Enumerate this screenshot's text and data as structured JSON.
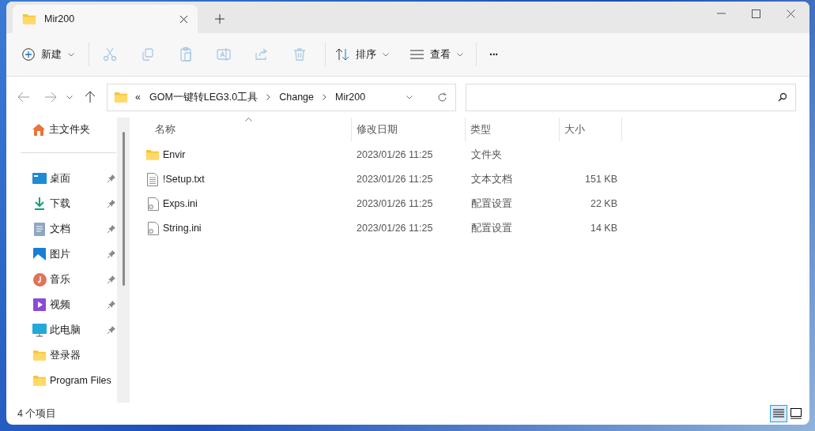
{
  "tabs": [
    {
      "title": "Mir200",
      "selected": true
    }
  ],
  "toolbar": {
    "new": "新建",
    "sort": "排序",
    "view": "查看",
    "more": "···"
  },
  "toolbar_actions": [
    {
      "kind": "cut",
      "disabled": true
    },
    {
      "kind": "copy",
      "disabled": true
    },
    {
      "kind": "paste",
      "disabled": true
    },
    {
      "kind": "rename",
      "disabled": true
    },
    {
      "kind": "share",
      "disabled": true
    },
    {
      "kind": "delete",
      "disabled": true
    }
  ],
  "address": {
    "overflow": "«",
    "crumbs": [
      "GOM一键转LEG3.0工具",
      "Change",
      "Mir200"
    ]
  },
  "sidebar": {
    "home": "主文件夹",
    "items": [
      {
        "label": "桌面",
        "kind": "desktop",
        "pinned": true
      },
      {
        "label": "下载",
        "kind": "download",
        "pinned": true
      },
      {
        "label": "文档",
        "kind": "document",
        "pinned": true
      },
      {
        "label": "图片",
        "kind": "pictures",
        "pinned": true
      },
      {
        "label": "音乐",
        "kind": "music",
        "pinned": true
      },
      {
        "label": "视频",
        "kind": "video",
        "pinned": true
      },
      {
        "label": "此电脑",
        "kind": "pc",
        "pinned": true
      },
      {
        "label": "登录器",
        "kind": "folder",
        "pinned": false
      },
      {
        "label": "Program Files",
        "kind": "folder",
        "pinned": false
      }
    ]
  },
  "table": {
    "columns": [
      "名称",
      "修改日期",
      "类型",
      "大小"
    ],
    "rows": [
      {
        "name": "Envir",
        "kind": "folder",
        "date": "2023/01/26 11:25",
        "type": "文件夹"
      },
      {
        "name": "!Setup.txt",
        "kind": "text",
        "date": "2023/01/26 11:25",
        "type": "文本文档",
        "size": "151 KB"
      },
      {
        "name": "Exps.ini",
        "kind": "config",
        "date": "2023/01/26 11:25",
        "type": "配置设置",
        "size": "22 KB"
      },
      {
        "name": "String.ini",
        "kind": "config",
        "date": "2023/01/26 11:25",
        "type": "配置设置",
        "size": "14 KB"
      }
    ]
  },
  "status_bar": {
    "count": "4 个项目"
  },
  "view_modes": [
    {
      "kind": "details",
      "selected": true
    },
    {
      "kind": "tiles",
      "selected": false
    }
  ]
}
